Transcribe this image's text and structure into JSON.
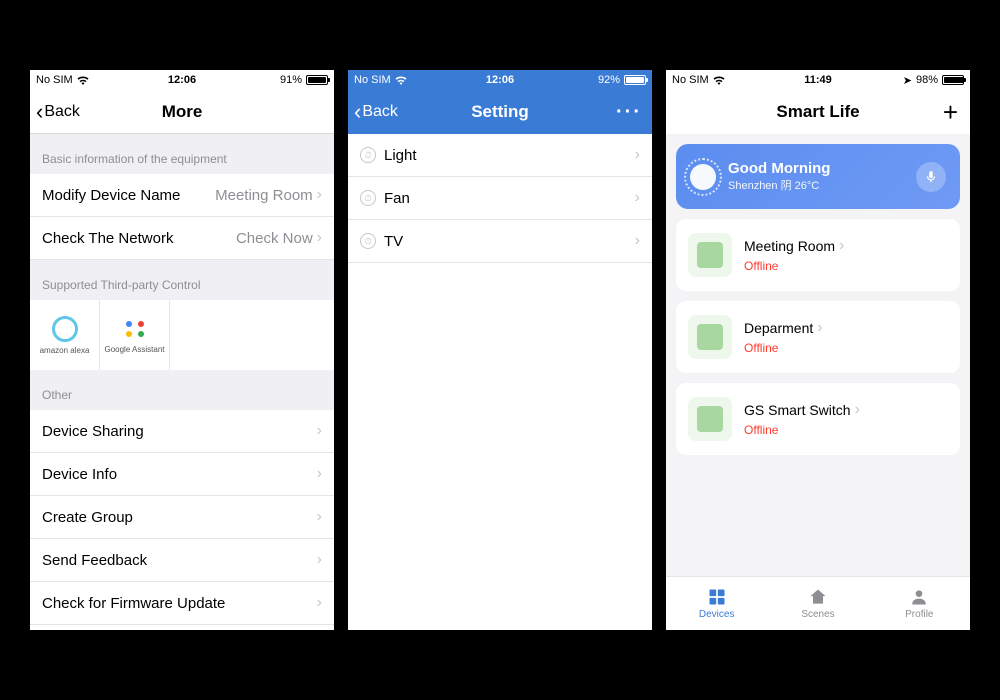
{
  "screen1": {
    "status": {
      "carrier": "No SIM",
      "time": "12:06",
      "battery_pct": "91%",
      "battery_fill": 91
    },
    "nav": {
      "back": "Back",
      "title": "More"
    },
    "section_basic": "Basic information of the equipment",
    "row_name": {
      "label": "Modify Device Name",
      "value": "Meeting Room"
    },
    "row_network": {
      "label": "Check The Network",
      "value": "Check Now"
    },
    "section_tp": "Supported Third-party Control",
    "tp": {
      "alexa": "amazon alexa",
      "ga": "Google Assistant"
    },
    "section_other": "Other",
    "other": [
      "Device Sharing",
      "Device Info",
      "Create Group",
      "Send Feedback",
      "Check for Firmware Update"
    ]
  },
  "screen2": {
    "status": {
      "carrier": "No SIM",
      "time": "12:06",
      "battery_pct": "92%",
      "battery_fill": 92
    },
    "nav": {
      "back": "Back",
      "title": "Setting"
    },
    "items": [
      "Light",
      "Fan",
      "TV"
    ]
  },
  "screen3": {
    "status": {
      "carrier": "No SIM",
      "time": "11:49",
      "battery_pct": "98%",
      "battery_fill": 98
    },
    "title": "Smart Life",
    "greeting": {
      "title": "Good Morning",
      "sub": "Shenzhen 阴 26°C"
    },
    "devices": [
      {
        "name": "Meeting Room",
        "status": "Offline"
      },
      {
        "name": "Deparment",
        "status": "Offline"
      },
      {
        "name": "GS Smart Switch",
        "status": "Offline"
      }
    ],
    "tabs": {
      "devices": "Devices",
      "scenes": "Scenes",
      "profile": "Profile"
    }
  }
}
